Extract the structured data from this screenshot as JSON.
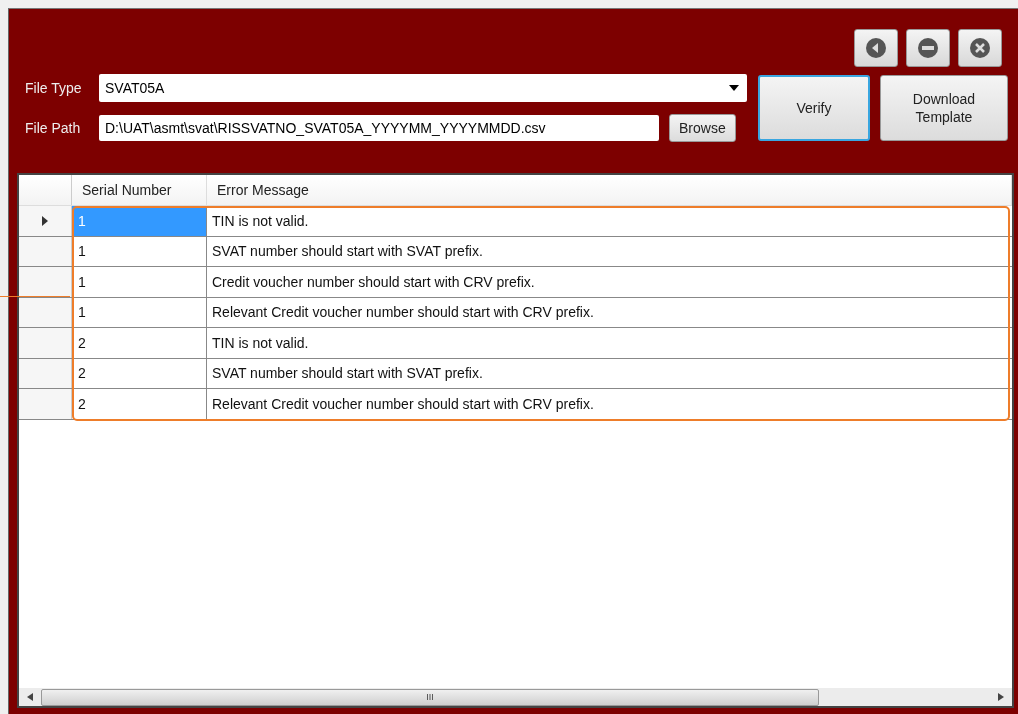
{
  "window_buttons": [
    {
      "kind": "back"
    },
    {
      "kind": "minimize"
    },
    {
      "kind": "close"
    }
  ],
  "file_type": {
    "label": "File Type",
    "value": "SVAT05A"
  },
  "file_path": {
    "label": "File Path",
    "value": "D:\\UAT\\asmt\\svat\\RISSVATNO_SVAT05A_YYYYMM_YYYYMMDD.csv"
  },
  "browse_button": "Browse",
  "verify_button": {
    "label": "Verify",
    "focused": true
  },
  "download_button": "Download Template",
  "table": {
    "columns": [
      "Serial Number",
      "Error Message"
    ],
    "rows": [
      {
        "serial": "1",
        "message": "TIN is not valid.",
        "selected": true
      },
      {
        "serial": "1",
        "message": "SVAT number should start with SVAT prefix.",
        "selected": false
      },
      {
        "serial": "1",
        "message": "Credit voucher number should start with CRV prefix.",
        "selected": false
      },
      {
        "serial": "1",
        "message": "Relevant Credit voucher number should start with CRV prefix.",
        "selected": false
      },
      {
        "serial": "2",
        "message": "TIN is not valid.",
        "selected": false
      },
      {
        "serial": "2",
        "message": "SVAT number should start with SVAT prefix.",
        "selected": false
      },
      {
        "serial": "2",
        "message": "Relevant Credit voucher number should start with CRV prefix.",
        "selected": false
      }
    ]
  },
  "scrollbar_grip": "III"
}
